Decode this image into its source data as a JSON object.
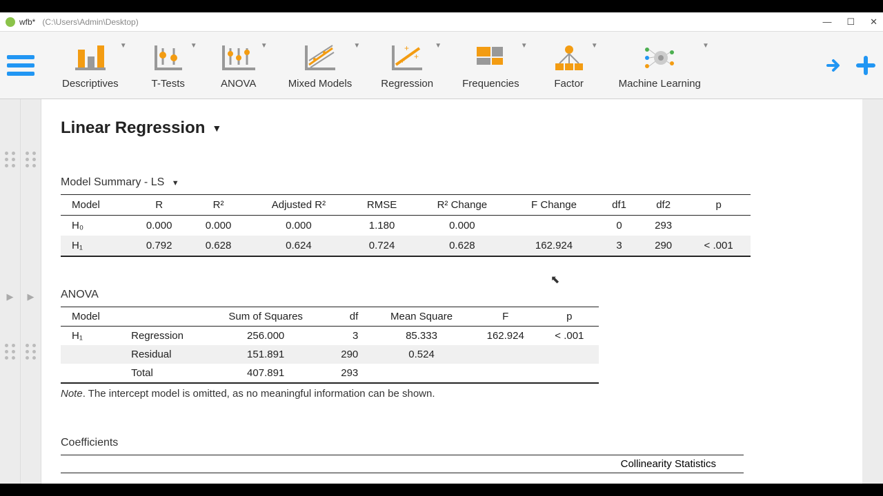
{
  "window": {
    "title": "wfb*",
    "path": "(C:\\Users\\Admin\\Desktop)"
  },
  "toolbar": {
    "items": [
      "Descriptives",
      "T-Tests",
      "ANOVA",
      "Mixed Models",
      "Regression",
      "Frequencies",
      "Factor",
      "Machine Learning"
    ]
  },
  "page": {
    "title": "Linear Regression",
    "summary_title": "Model Summary - LS",
    "summary_headers": [
      "Model",
      "R",
      "R²",
      "Adjusted R²",
      "RMSE",
      "R² Change",
      "F Change",
      "df1",
      "df2",
      "p"
    ],
    "summary_rows": [
      {
        "model": "H₀",
        "R": "0.000",
        "R2": "0.000",
        "adjR2": "0.000",
        "RMSE": "1.180",
        "R2c": "0.000",
        "Fc": "",
        "df1": "0",
        "df2": "293",
        "p": ""
      },
      {
        "model": "H₁",
        "R": "0.792",
        "R2": "0.628",
        "adjR2": "0.624",
        "RMSE": "0.724",
        "R2c": "0.628",
        "Fc": "162.924",
        "df1": "3",
        "df2": "290",
        "p": "< .001"
      }
    ],
    "anova_title": "ANOVA",
    "anova_headers": [
      "Model",
      "",
      "Sum of Squares",
      "df",
      "Mean Square",
      "F",
      "p"
    ],
    "anova_rows": [
      {
        "model": "H₁",
        "src": "Regression",
        "ss": "256.000",
        "df": "3",
        "ms": "85.333",
        "F": "162.924",
        "p": "< .001"
      },
      {
        "model": "",
        "src": "Residual",
        "ss": "151.891",
        "df": "290",
        "ms": "0.524",
        "F": "",
        "p": ""
      },
      {
        "model": "",
        "src": "Total",
        "ss": "407.891",
        "df": "293",
        "ms": "",
        "F": "",
        "p": ""
      }
    ],
    "anova_note_prefix": "Note",
    "anova_note": ". The intercept model is omitted, as no meaningful information can be shown.",
    "coef_title": "Coefficients",
    "coef_subhead": "Collinearity Statistics"
  }
}
